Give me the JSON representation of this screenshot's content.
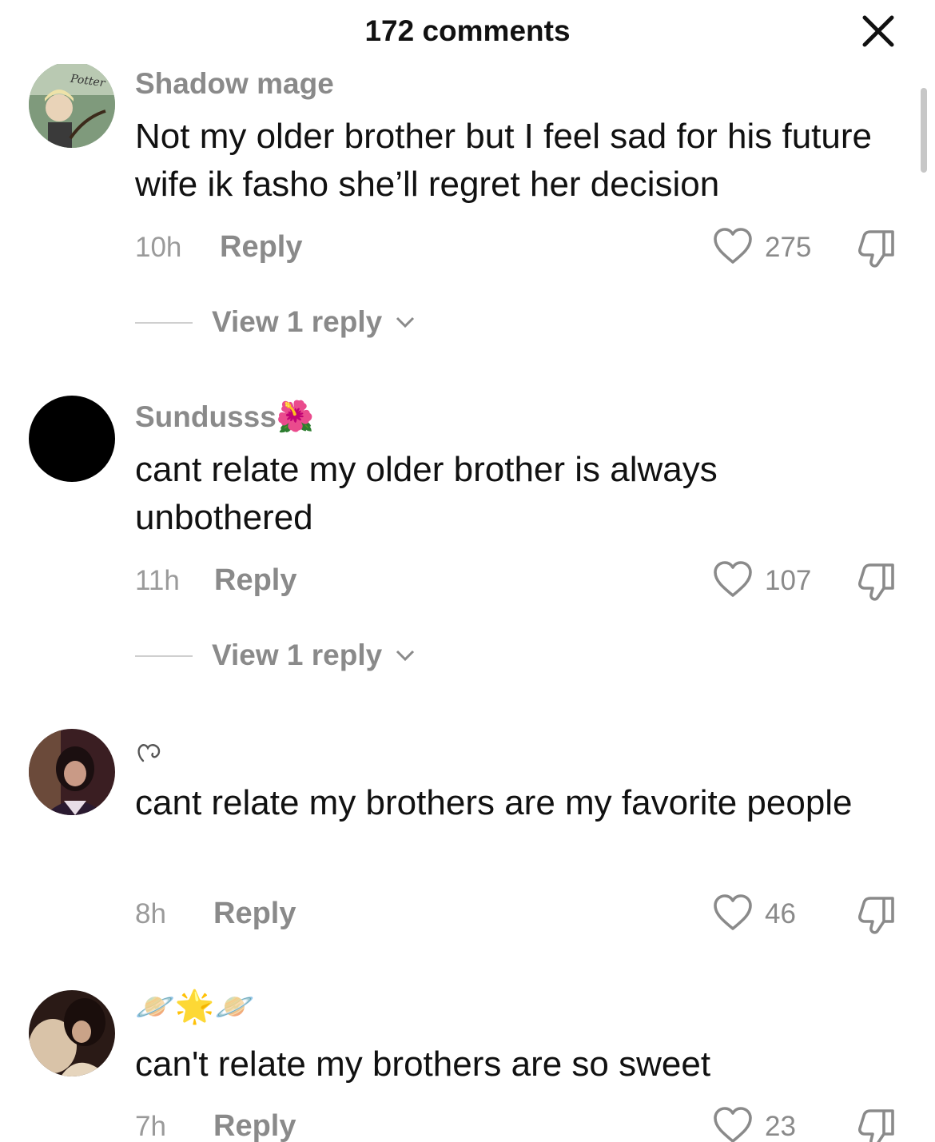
{
  "header": {
    "title": "172 comments"
  },
  "comments": [
    {
      "username": "Shadow mage",
      "text": "Not my older brother but I feel sad for his future wife ik fasho she’ll regret her decision",
      "time": "10h",
      "reply_label": "Reply",
      "likes": "275",
      "view_replies": "View 1 reply",
      "avatar_icon": "wizard-avatar-icon",
      "avatar_caption": "Potter"
    },
    {
      "username": "Sundusss",
      "username_emoji": "🌺",
      "text": "cant relate my older brother is always unbothered",
      "time": "11h",
      "reply_label": "Reply",
      "likes": "107",
      "view_replies": "View 1 reply",
      "avatar_icon": "black-circle-avatar"
    },
    {
      "username": "",
      "username_icon": "doodle-heart-icon",
      "text": "cant relate my brothers are my favorite people",
      "time": "8h",
      "reply_label": "Reply",
      "likes": "46",
      "avatar_icon": "portrait-avatar"
    },
    {
      "username": "",
      "username_emoji": "🪐🌟🪐",
      "text": "can't relate my brothers are so sweet",
      "time": "7h",
      "reply_label": "Reply",
      "likes": "23",
      "avatar_icon": "portrait-avatar"
    }
  ],
  "colors": {
    "muted": "#8a8a8a",
    "text": "#111111",
    "background": "#ffffff"
  }
}
